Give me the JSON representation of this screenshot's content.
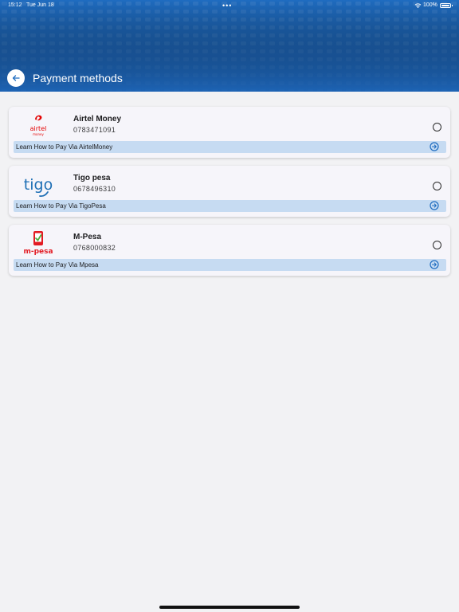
{
  "status_bar": {
    "time": "15:12",
    "date": "Tue Jun 18",
    "dots": "•••",
    "battery": "100%"
  },
  "header": {
    "title": "Payment methods",
    "back_icon": "arrow-left-icon",
    "color": "#1f6cc0"
  },
  "payment_methods": [
    {
      "name": "Airtel Money",
      "phone": "0783471091",
      "logo": "airtel-logo",
      "logo_text": "airtel",
      "logo_subtext": "money",
      "learn_label": "Learn How to Pay Via AirtelMoney",
      "selected": false
    },
    {
      "name": "Tigo pesa",
      "phone": "0678496310",
      "logo": "tigo-logo",
      "logo_text": "tigo",
      "learn_label": "Learn How to Pay Via TigoPesa",
      "selected": false
    },
    {
      "name": "M-Pesa",
      "phone": "0768000832",
      "logo": "mpesa-logo",
      "logo_text": "m-pesa",
      "learn_label": "Learn How to Pay Via Mpesa",
      "selected": false
    }
  ],
  "colors": {
    "accent": "#1f6cc0",
    "learn_bar": "#c6dbf2",
    "airtel_red": "#e40000",
    "tigo_blue": "#1e6fb5",
    "mpesa_red": "#e21b23",
    "mpesa_green": "#4caf3f"
  }
}
